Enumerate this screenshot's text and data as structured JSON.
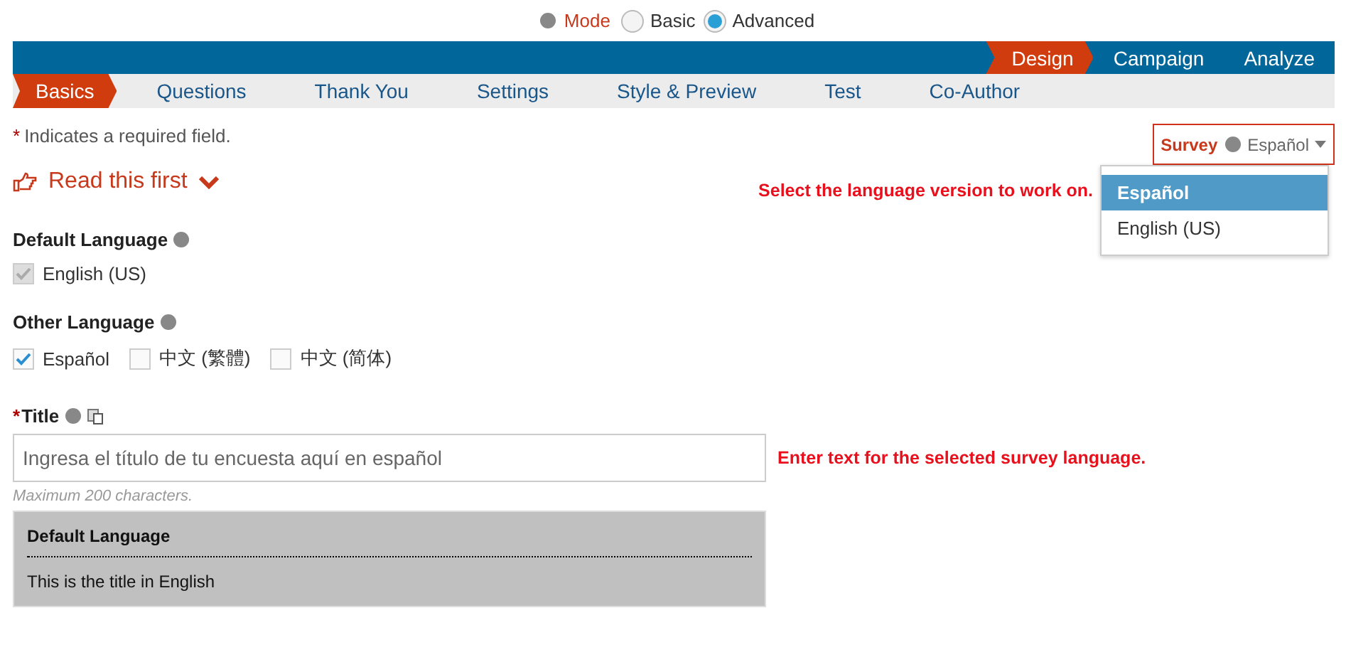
{
  "mode": {
    "label": "Mode",
    "options": [
      {
        "label": "Basic",
        "selected": false
      },
      {
        "label": "Advanced",
        "selected": true
      }
    ]
  },
  "main_tabs": [
    {
      "label": "Design",
      "selected": true
    },
    {
      "label": "Campaign",
      "selected": false
    },
    {
      "label": "Analyze",
      "selected": false
    }
  ],
  "sub_tabs": [
    {
      "label": "Basics",
      "selected": true
    },
    {
      "label": "Questions",
      "selected": false
    },
    {
      "label": "Thank You",
      "selected": false
    },
    {
      "label": "Settings",
      "selected": false
    },
    {
      "label": "Style & Preview",
      "selected": false
    },
    {
      "label": "Test",
      "selected": false
    },
    {
      "label": "Co-Author",
      "selected": false
    }
  ],
  "required_note": {
    "mark": "*",
    "text": "Indicates a required field."
  },
  "read_first": "Read this first",
  "survey_language": {
    "label": "Survey",
    "value": "Español",
    "options": [
      {
        "label": "Español",
        "selected": true
      },
      {
        "label": "English (US)",
        "selected": false
      }
    ]
  },
  "hints": [
    "Select the language version to work on.",
    "Enter text for the selected survey language."
  ],
  "default_language": {
    "label": "Default Language",
    "options": [
      {
        "label": "English (US)",
        "checked": true,
        "disabled": true
      }
    ]
  },
  "other_language": {
    "label": "Other Language",
    "options": [
      {
        "label": "Español",
        "checked": true,
        "disabled": false
      },
      {
        "label": "中文 (繁體)",
        "checked": false,
        "disabled": false
      },
      {
        "label": "中文 (简体)",
        "checked": false,
        "disabled": false
      }
    ]
  },
  "title_field": {
    "mark": "*",
    "label": "Title",
    "placeholder": "Ingresa el título de tu encuesta aquí en español",
    "note": "Maximum 200 characters."
  },
  "default_panel": {
    "heading": "Default Language",
    "text": "This is the title in English"
  }
}
